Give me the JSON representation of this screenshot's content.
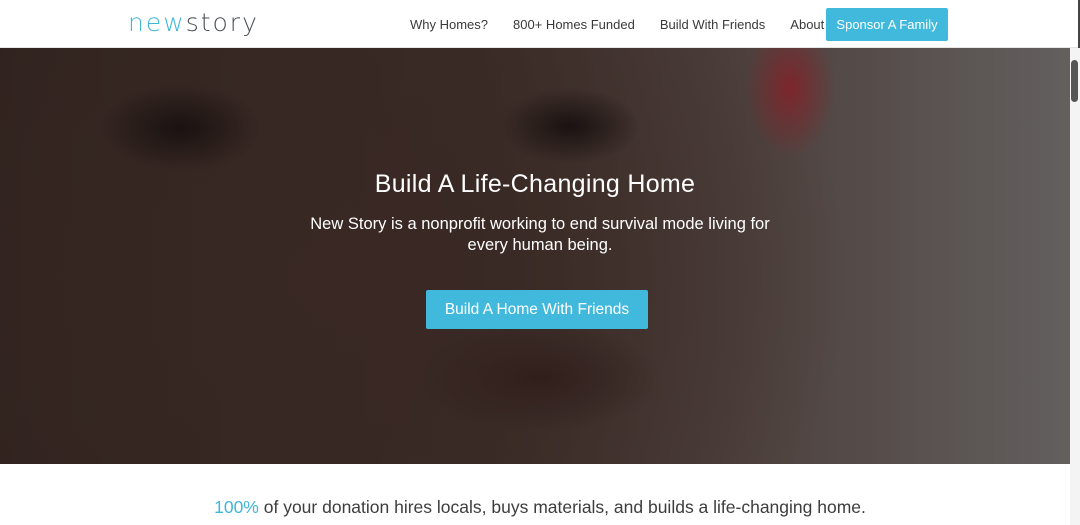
{
  "brand": {
    "logo_new": "new",
    "logo_story": "story",
    "accent_color": "#40b9dc"
  },
  "nav": {
    "links": [
      "Why Homes?",
      "800+ Homes Funded",
      "Build With Friends",
      "About"
    ],
    "cta_label": "Sponsor A Family"
  },
  "hero": {
    "title": "Build A Life-Changing Home",
    "subtitle": "New Story is a nonprofit working to end survival mode living for every human being.",
    "button_label": "Build A Home With Friends"
  },
  "tagline": {
    "highlight": "100%",
    "rest": " of your donation hires locals, buys materials, and builds a life-changing home."
  }
}
